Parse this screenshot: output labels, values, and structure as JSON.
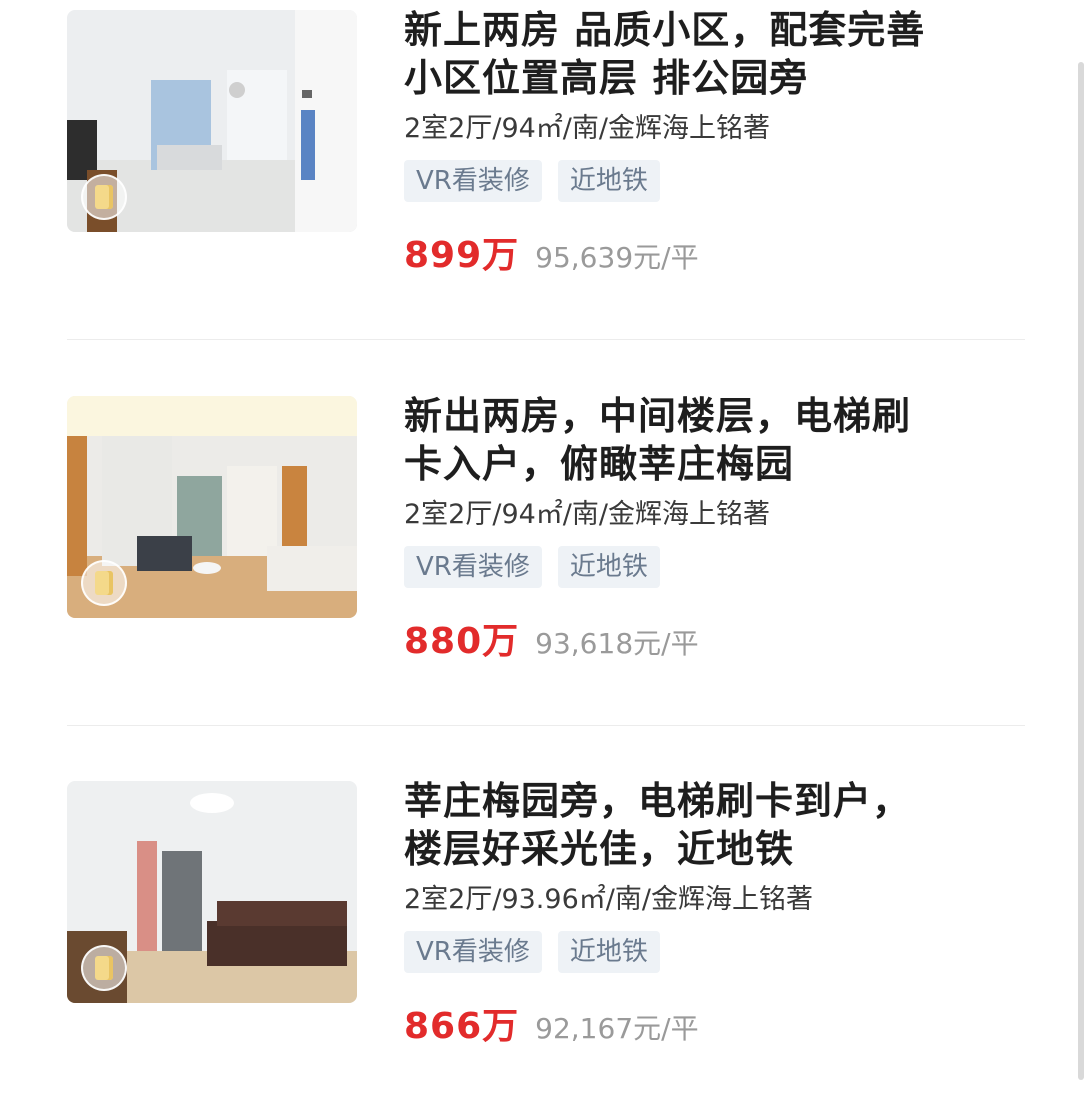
{
  "listings": [
    {
      "title_line1": "新上两房 品质小区，配套完善",
      "title_line2": "小区位置高层 排公园旁",
      "meta": "2室2厅/94㎡/南/金辉海上铭著",
      "tags": [
        "VR看装修",
        "近地铁"
      ],
      "price": "899万",
      "unit_price": "95,639元/平"
    },
    {
      "title_line1": "新出两房，中间楼层，电梯刷",
      "title_line2": "卡入户，俯瞰莘庄梅园",
      "meta": "2室2厅/94㎡/南/金辉海上铭著",
      "tags": [
        "VR看装修",
        "近地铁"
      ],
      "price": "880万",
      "unit_price": "93,618元/平"
    },
    {
      "title_line1": "莘庄梅园旁，电梯刷卡到户，",
      "title_line2": "楼层好采光佳，近地铁",
      "meta": "2室2厅/93.96㎡/南/金辉海上铭著",
      "tags": [
        "VR看装修",
        "近地铁"
      ],
      "price": "866万",
      "unit_price": "92,167元/平"
    }
  ],
  "colors": {
    "price": "#e22b2b",
    "tag_bg": "#eef2f6",
    "tag_text": "#6a7a8e",
    "unit_price": "#9a9a9a"
  },
  "icons": [
    "vr-icon"
  ]
}
